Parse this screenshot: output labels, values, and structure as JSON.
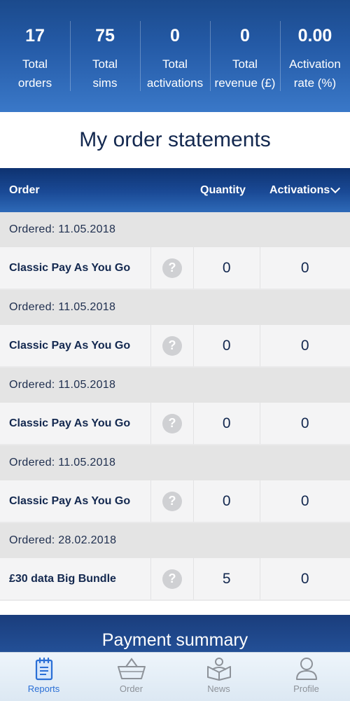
{
  "stats": [
    {
      "value": "17",
      "label_line1": "Total",
      "label_line2": "orders"
    },
    {
      "value": "75",
      "label_line1": "Total",
      "label_line2": "sims"
    },
    {
      "value": "0",
      "label_line1": "Total",
      "label_line2": "activations"
    },
    {
      "value": "0",
      "label_line1": "Total",
      "label_line2": "revenue (£)"
    },
    {
      "value": "0.00",
      "label_line1": "Activation",
      "label_line2": "rate (%)"
    }
  ],
  "page_title": "My order statements",
  "table": {
    "headers": {
      "order": "Order",
      "quantity": "Quantity",
      "activations": "Activations"
    },
    "help_icon_glyph": "?",
    "groups": [
      {
        "date": "Ordered: 11.05.2018",
        "name": "Classic Pay As You Go",
        "quantity": "0",
        "activations": "0"
      },
      {
        "date": "Ordered: 11.05.2018",
        "name": "Classic Pay As You Go",
        "quantity": "0",
        "activations": "0"
      },
      {
        "date": "Ordered: 11.05.2018",
        "name": "Classic Pay As You Go",
        "quantity": "0",
        "activations": "0"
      },
      {
        "date": "Ordered: 11.05.2018",
        "name": "Classic Pay As You Go",
        "quantity": "0",
        "activations": "0"
      },
      {
        "date": "Ordered: 28.02.2018",
        "name": "£30 data Big Bundle",
        "quantity": "5",
        "activations": "0"
      }
    ]
  },
  "payment_summary": "Payment summary",
  "tabbar": {
    "active_color": "#2a6fd6",
    "inactive_color": "#8d9299",
    "tabs": [
      {
        "label": "Reports",
        "icon": "reports-icon",
        "active": true
      },
      {
        "label": "Order",
        "icon": "basket-icon",
        "active": false
      },
      {
        "label": "News",
        "icon": "news-icon",
        "active": false
      },
      {
        "label": "Profile",
        "icon": "profile-icon",
        "active": false
      }
    ]
  }
}
